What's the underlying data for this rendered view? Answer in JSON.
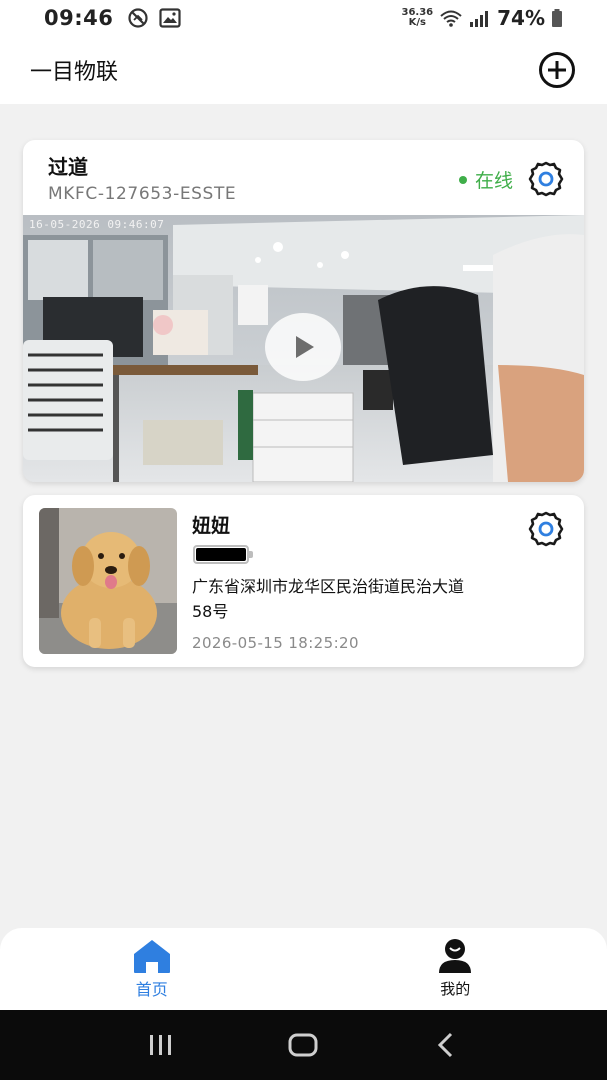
{
  "status_bar": {
    "time": "09:46",
    "net_speed_value": "36.36",
    "net_speed_unit": "K/s",
    "battery": "74%"
  },
  "header": {
    "title": "一目物联"
  },
  "camera_card": {
    "name": "过道",
    "device_id": "MKFC-127653-ESSTE",
    "status": "在线",
    "status_color": "#3fae49",
    "video_timestamp": "16-05-2026 09:46:07"
  },
  "pet_card": {
    "name": "妞妞",
    "battery_level": 1.0,
    "address": "广东省深圳市龙华区民治街道民治大道58号",
    "timestamp": "2026-05-15 18:25:20"
  },
  "bottom_nav": {
    "items": [
      {
        "label": "首页",
        "icon": "home-icon",
        "active": true
      },
      {
        "label": "我的",
        "icon": "profile-icon",
        "active": false
      }
    ],
    "active_color": "#2f7fe0"
  }
}
